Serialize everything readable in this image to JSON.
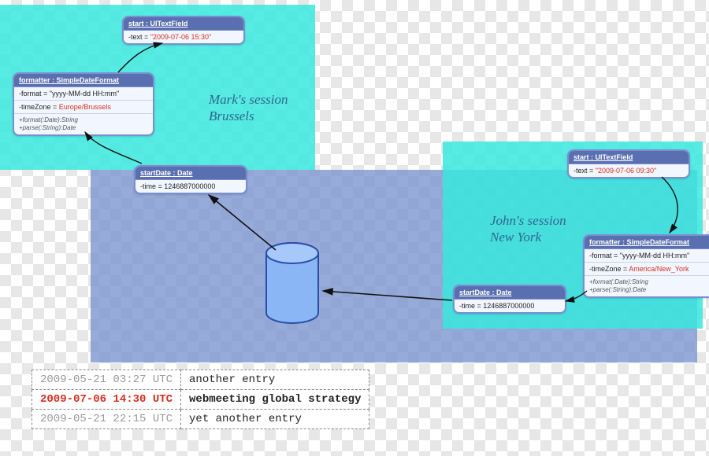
{
  "sessions": {
    "mark": {
      "captionLine1": "Mark's session",
      "captionLine2": "Brussels"
    },
    "john": {
      "captionLine1": "John's session",
      "captionLine2": "New York"
    }
  },
  "objects": {
    "markStart": {
      "head": "start : UITextField",
      "textLabel": "-text = ",
      "textValue": "\"2009-07-06 15:30\""
    },
    "markFormatter": {
      "head": "formatter : SimpleDateFormat",
      "formatLabel": "-format = ",
      "formatValue": "\"yyyy-MM-dd HH:mm\"",
      "tzLabel": "-timeZone = ",
      "tzValue": "Europe/Brussels",
      "op1": "+format(:Date):String",
      "op2": "+parse(:String):Date"
    },
    "markStartDate": {
      "head": "startDate : Date",
      "timeLabel": "-time = ",
      "timeValue": "1246887000000"
    },
    "johnStart": {
      "head": "start : UITextField",
      "textLabel": "-text = ",
      "textValue": "\"2009-07-06 09:30\""
    },
    "johnFormatter": {
      "head": "formatter : SimpleDateFormat",
      "formatLabel": "-format = ",
      "formatValue": "\"yyyy-MM-dd HH:mm\"",
      "tzLabel": "-timeZone = ",
      "tzValue": "America/New_York",
      "op1": "+format(:Date):String",
      "op2": "+parse(:String):Date"
    },
    "johnStartDate": {
      "head": "startDate : Date",
      "timeLabel": "-time = ",
      "timeValue": "1246887000000"
    }
  },
  "log": [
    {
      "ts": "2009-05-21 03:27 UTC",
      "msg": "another entry",
      "active": false
    },
    {
      "ts": "2009-07-06 14:30 UTC",
      "msg": "webmeeting global strategy",
      "active": true
    },
    {
      "ts": "2009-05-21 22:15 UTC",
      "msg": "yet another entry",
      "active": false
    }
  ],
  "colors": {
    "cyan": "#38e8de",
    "slate": "#7894ce",
    "boxBorder": "#7b8fd0",
    "boxHead": "#5a6fb0",
    "highlight": "#d62f1f",
    "dbFill": "#8bb6f5",
    "dbStroke": "#2a4fa8"
  }
}
